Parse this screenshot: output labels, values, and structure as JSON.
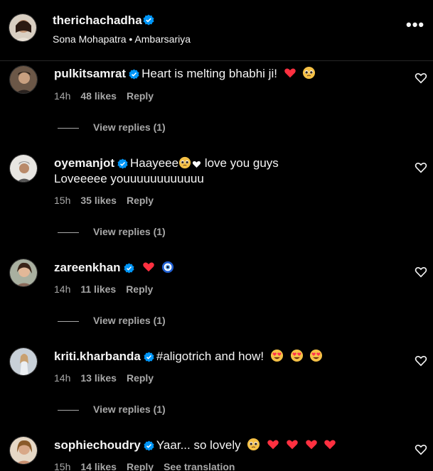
{
  "post": {
    "author": "therichachadha",
    "subline": "Sona Mohapatra • Ambarsariya",
    "more": "•••"
  },
  "colors": {
    "verified": "#0095f6",
    "heart": "#ff3040",
    "muted": "#a8a8a8",
    "background": "#000000"
  },
  "comments": [
    {
      "username": "pulkitsamrat",
      "text": "Heart is melting bhabhi ji!",
      "emojis": [
        "red-heart",
        "pleading-face"
      ],
      "time": "14h",
      "likes": "48 likes",
      "reply": "Reply",
      "view_replies": "View replies (1)"
    },
    {
      "username": "oyemanjot",
      "text": "Haayeee",
      "text_after": "love you guys",
      "line2": "Loveeeee youuuuuuuuuuuu",
      "emojis": [
        "pleading-face",
        "white-heart"
      ],
      "time": "15h",
      "likes": "35 likes",
      "reply": "Reply",
      "view_replies": "View replies (1)"
    },
    {
      "username": "zareenkhan",
      "text": "",
      "emojis": [
        "red-heart",
        "nazar-amulet"
      ],
      "time": "14h",
      "likes": "11 likes",
      "reply": "Reply",
      "view_replies": "View replies (1)"
    },
    {
      "username": "kriti.kharbanda",
      "text": "#aligotrich and how!",
      "emojis": [
        "heart-eyes",
        "heart-eyes",
        "heart-eyes"
      ],
      "time": "14h",
      "likes": "13 likes",
      "reply": "Reply",
      "view_replies": "View replies (1)"
    },
    {
      "username": "sophiechoudry",
      "text": "Yaar... so lovely",
      "emojis": [
        "pleading-face",
        "red-heart",
        "red-heart",
        "red-heart",
        "red-heart"
      ],
      "time": "15h",
      "likes": "14 likes",
      "reply": "Reply",
      "translate": "See translation"
    }
  ]
}
